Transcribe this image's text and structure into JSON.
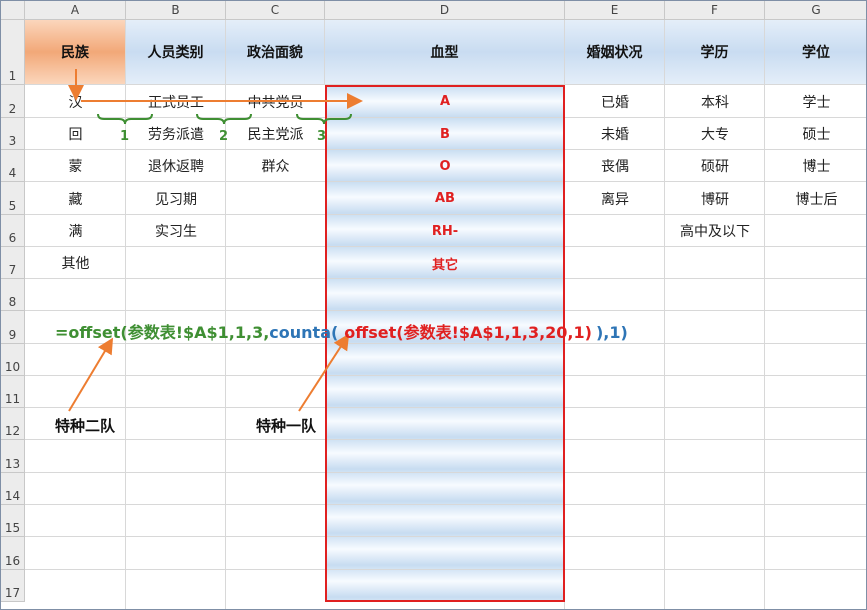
{
  "columns": [
    "A",
    "B",
    "C",
    "D",
    "E",
    "F",
    "G"
  ],
  "rows": [
    "1",
    "2",
    "3",
    "4",
    "5",
    "6",
    "7",
    "8",
    "9",
    "10",
    "11",
    "12",
    "13",
    "14",
    "15",
    "16",
    "17"
  ],
  "headers": {
    "a": "民族",
    "b": "人员类别",
    "c": "政治面貌",
    "d": "血型",
    "e": "婚姻状况",
    "f": "学历",
    "g": "学位"
  },
  "col_a": [
    "汉",
    "回",
    "蒙",
    "藏",
    "满",
    "其他"
  ],
  "col_b": [
    "正式员工",
    "劳务派遣",
    "退休返聘",
    "见习期",
    "实习生"
  ],
  "col_c": [
    "中共党员",
    "民主党派",
    "群众"
  ],
  "col_d": [
    "A",
    "B",
    "O",
    "AB",
    "RH-",
    "其它"
  ],
  "col_e": [
    "已婚",
    "未婚",
    "丧偶",
    "离异"
  ],
  "col_f": [
    "本科",
    "大专",
    "硕研",
    "博研",
    "高中及以下"
  ],
  "col_g": [
    "学士",
    "硕士",
    "博士",
    "博士后"
  ],
  "offset_numbers": [
    "1",
    "2",
    "3"
  ],
  "formula": {
    "part1": "=offset(参数表!$A$1,1,3,",
    "part2": "counta(",
    "part3": "offset(参数表!$A$1,1,3,20,1)",
    "part4": "),1)"
  },
  "labels": {
    "team2": "特种二队",
    "team1": "特种一队"
  },
  "colors": {
    "accent_orange": "#ed7d31",
    "accent_green": "#3f8f33",
    "highlight_red": "#e02020",
    "formula_blue": "#2e75b6"
  }
}
